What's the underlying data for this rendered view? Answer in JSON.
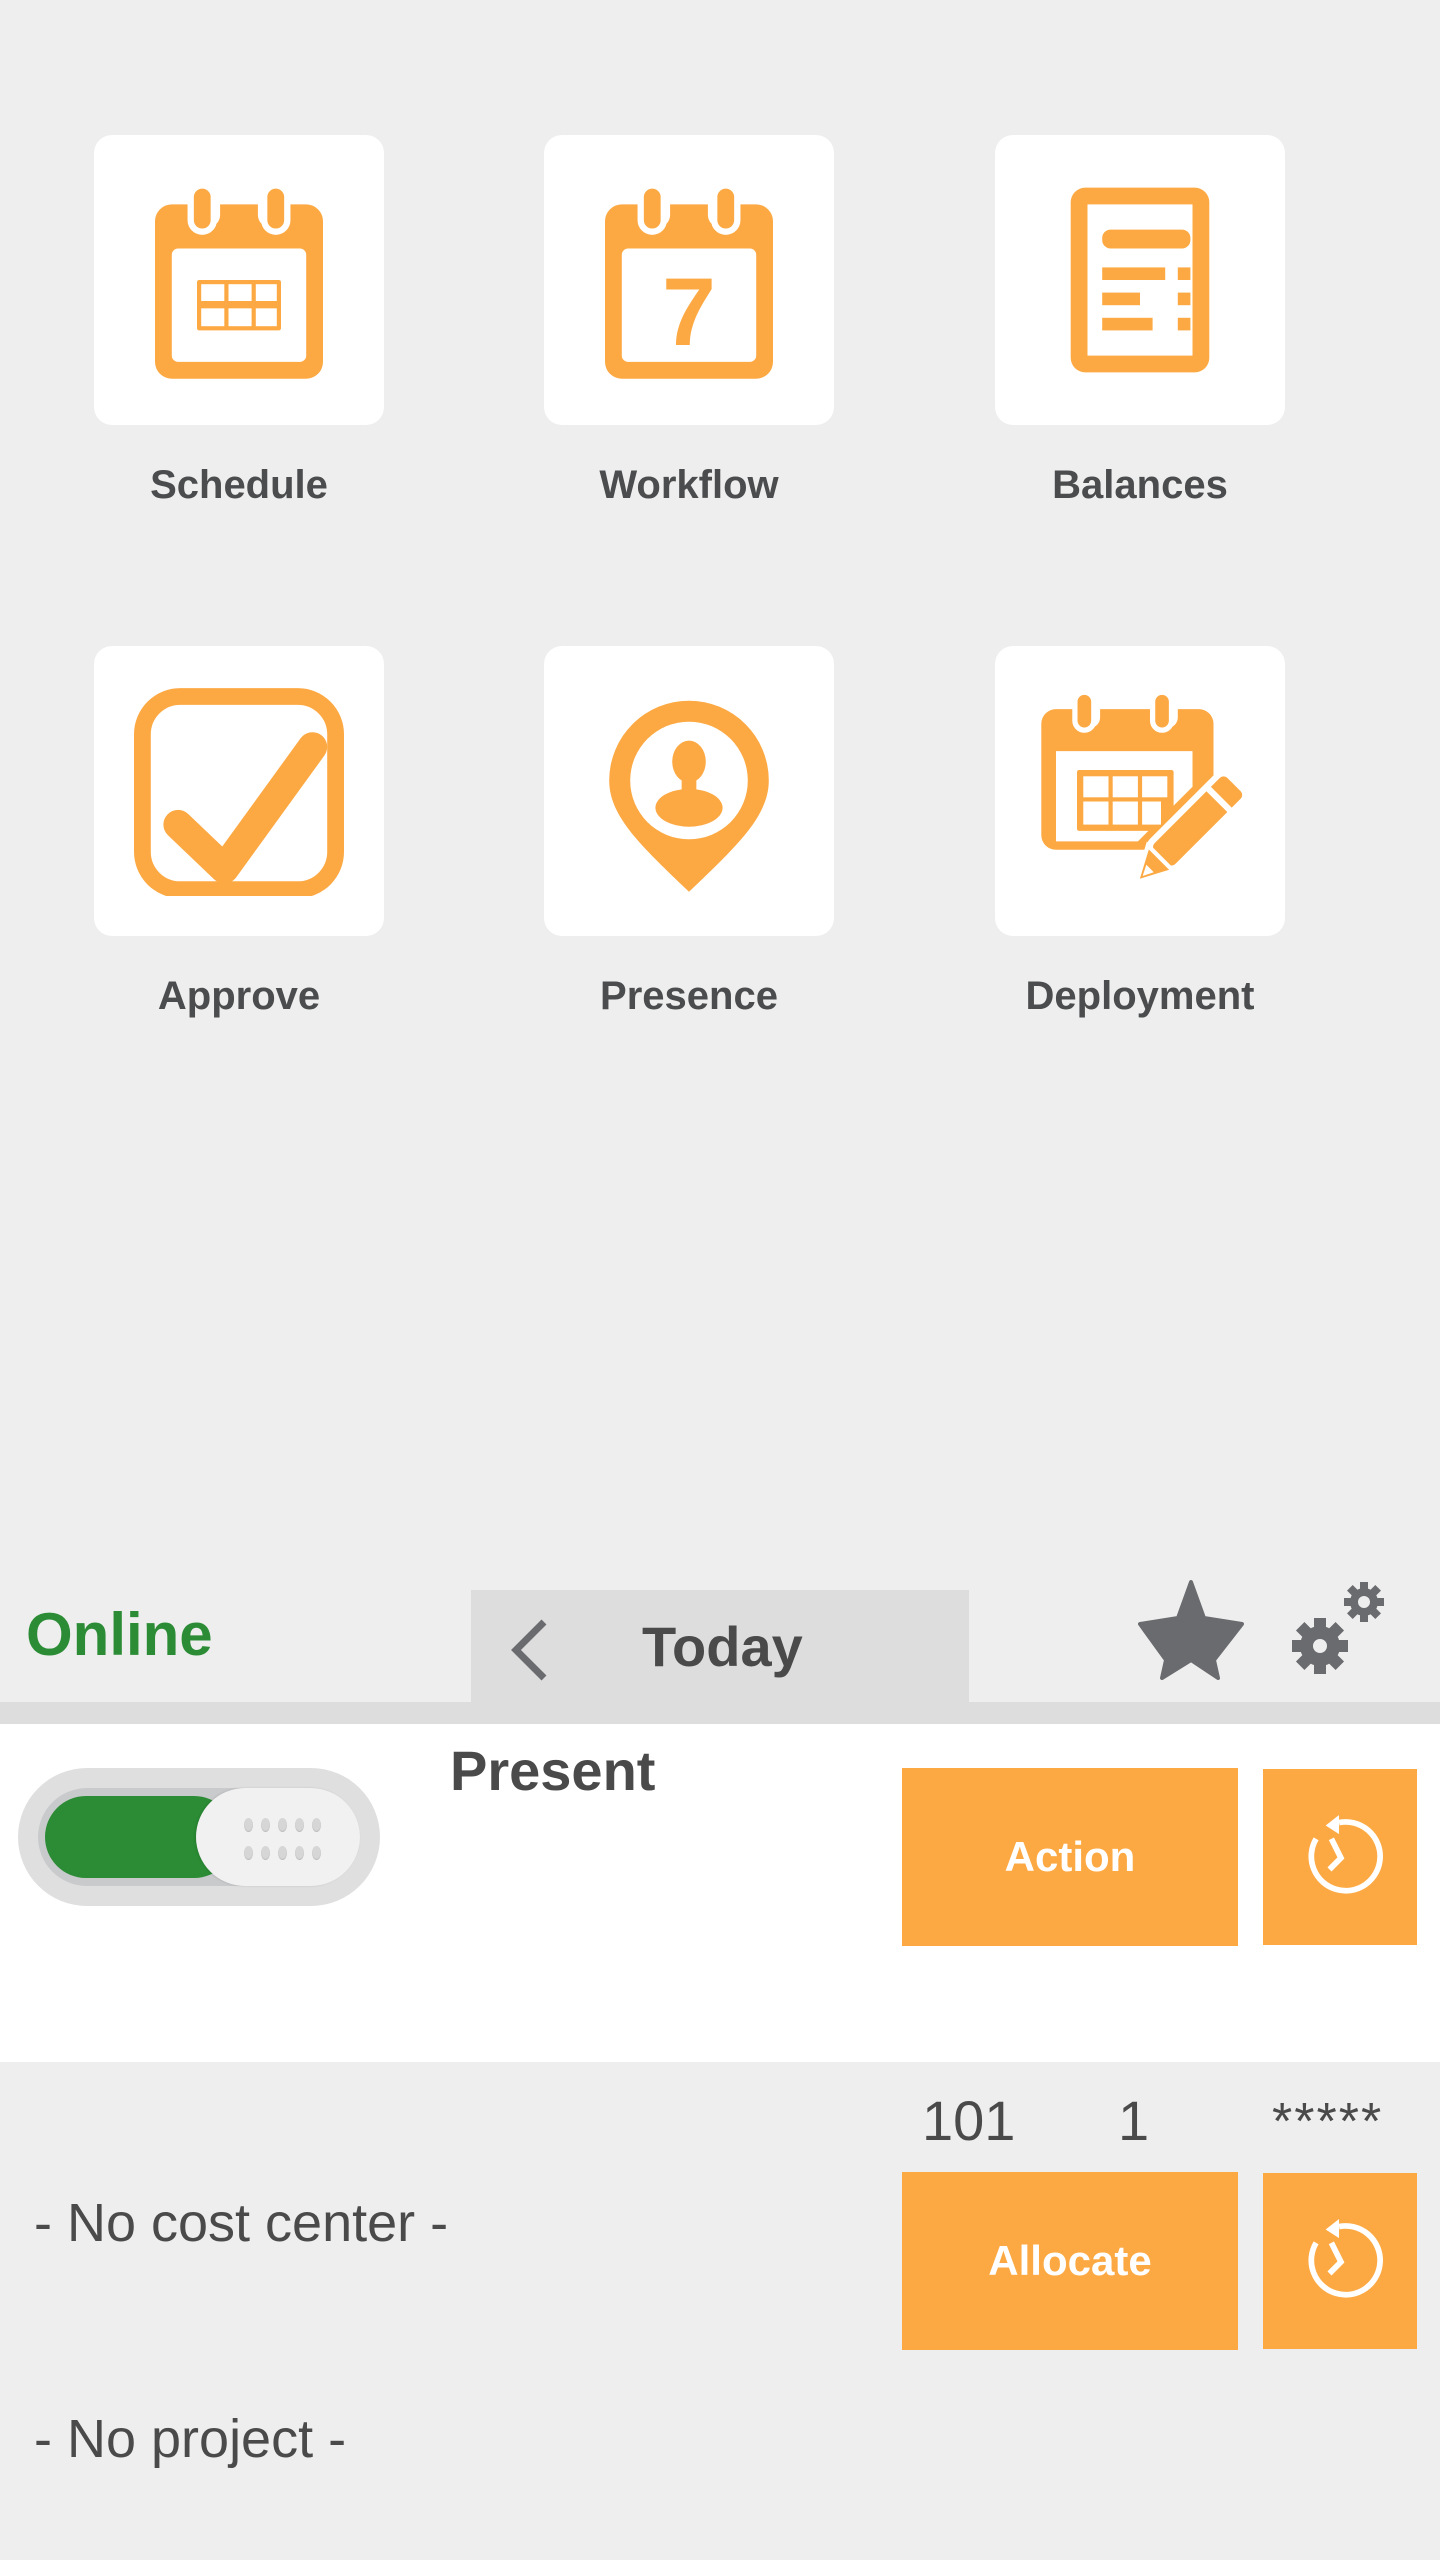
{
  "colors": {
    "accent": "#fda943",
    "online_green": "#2b8c35",
    "text_dark": "#4a4a4a",
    "icon_gray": "#696b6e",
    "background": "#eeeeee"
  },
  "tiles": [
    {
      "label": "Schedule",
      "icon": "calendar-grid-icon"
    },
    {
      "label": "Workflow",
      "icon": "calendar-day-7-icon",
      "icon_text": "7"
    },
    {
      "label": "Balances",
      "icon": "document-list-icon"
    },
    {
      "label": "Approve",
      "icon": "checkbox-checked-icon"
    },
    {
      "label": "Presence",
      "icon": "location-person-icon"
    },
    {
      "label": "Deployment",
      "icon": "calendar-edit-icon"
    }
  ],
  "header": {
    "status": "Online",
    "date_label": "Today",
    "back_icon": "chevron-left-icon",
    "favorite_icon": "star-icon",
    "settings_icon": "gears-icon"
  },
  "status_panel": {
    "toggle_state": "on",
    "state_label": "Present",
    "action_label": "Action",
    "history_icon": "clock-history-icon"
  },
  "allocation": {
    "values": [
      "101",
      "1",
      "*****"
    ],
    "cost_center": "- No cost center -",
    "project": "- No project -",
    "allocate_label": "Allocate",
    "history_icon": "clock-history-icon"
  }
}
